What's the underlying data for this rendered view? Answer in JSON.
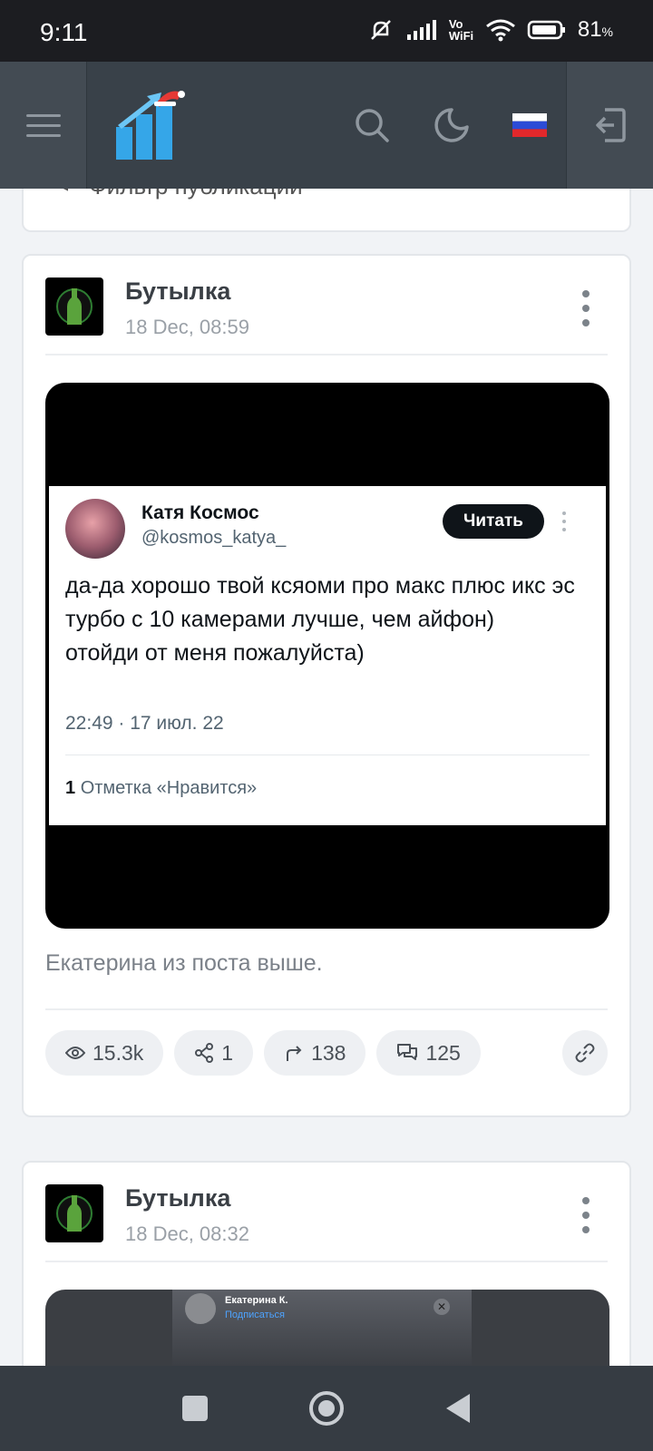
{
  "status_bar": {
    "time": "9:11",
    "network_label": "Vo WiFi",
    "battery": "81",
    "battery_unit": "%"
  },
  "header": {
    "language": "ru"
  },
  "filter": {
    "label": "Фильтр публикаций"
  },
  "posts": [
    {
      "author": "Бутылка",
      "date": "18 Dec, 08:59",
      "tweet": {
        "name": "Катя Космос",
        "handle": "@kosmos_katya_",
        "follow_label": "Читать",
        "text": "да-да хорошо твой ксяоми про макс плюс икс эс турбо с 10 камерами лучше, чем айфон)\nотойди от меня пожалуйста)",
        "meta": "22:49 · 17 июл. 22",
        "likes_count": "1",
        "likes_label": "Отметка «Нравится»"
      },
      "caption": "Екатерина из поста выше.",
      "stats": {
        "views": "15.3k",
        "shares": "1",
        "reposts": "138",
        "comments": "125"
      }
    },
    {
      "author": "Бутылка",
      "date": "18 Dec, 08:32",
      "preview": {
        "user": "Екатерина К.",
        "subscribe": "Подписаться"
      }
    }
  ]
}
